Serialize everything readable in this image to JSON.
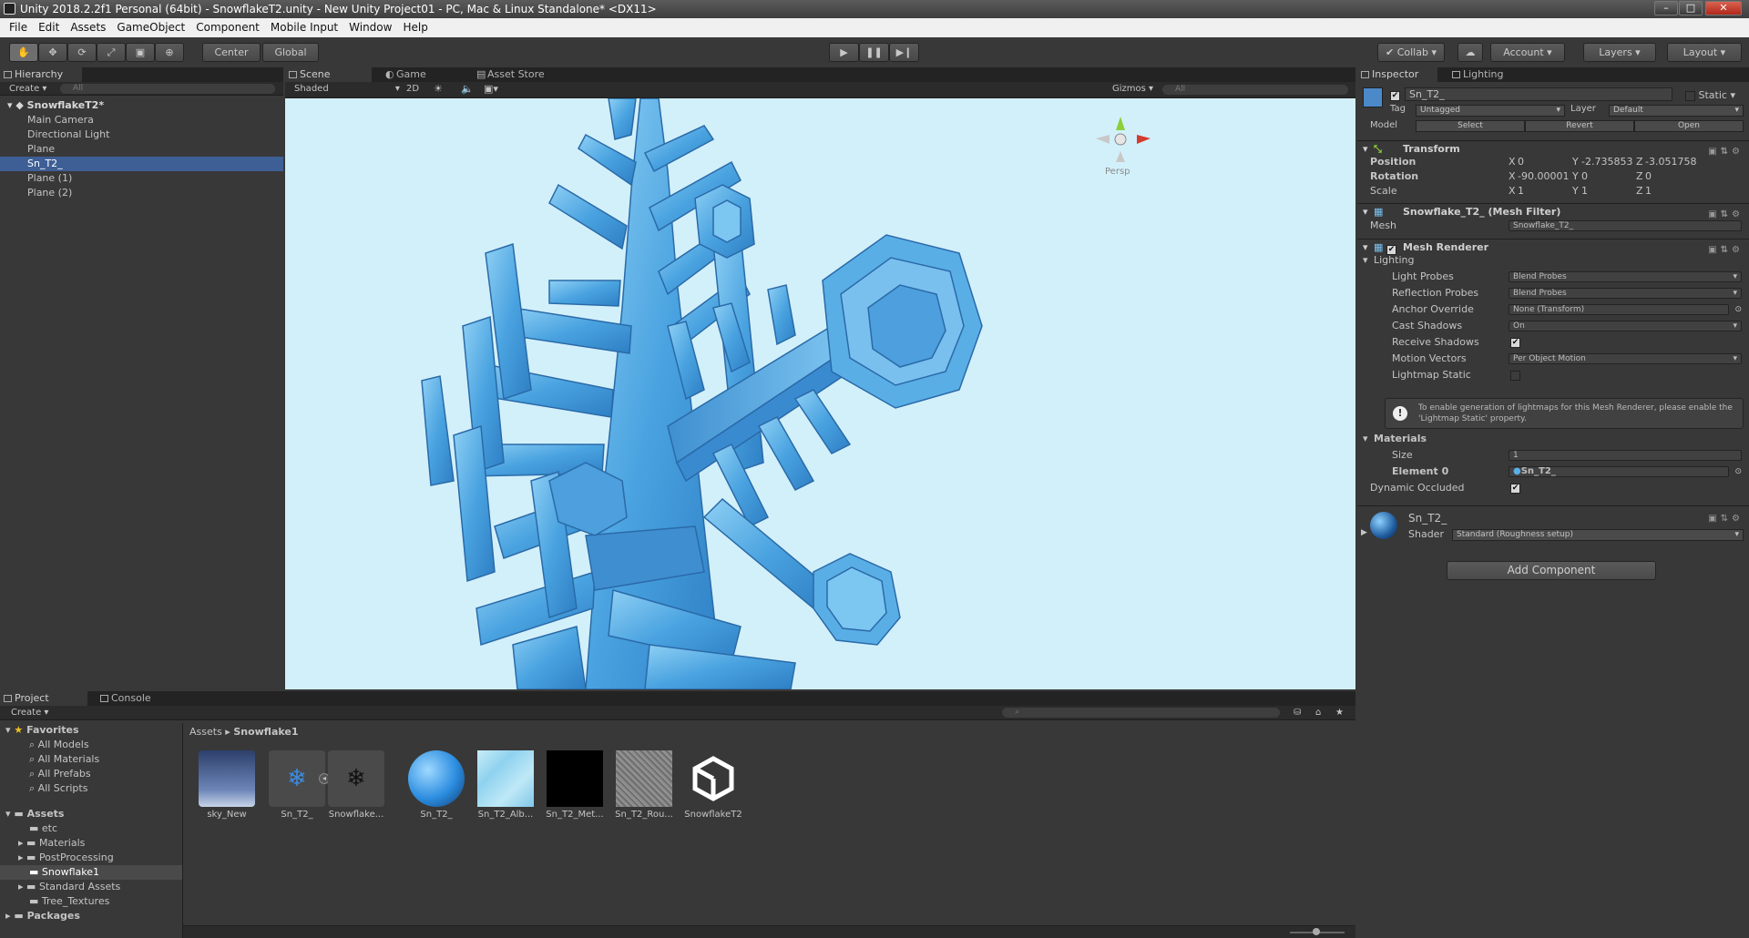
{
  "window": {
    "title": "Unity 2018.2.2f1 Personal (64bit) - SnowflakeT2.unity - New Unity Project01 - PC, Mac & Linux Standalone* <DX11>",
    "minimize": "–",
    "maximize": "□",
    "close": "✕"
  },
  "menu": [
    "File",
    "Edit",
    "Assets",
    "GameObject",
    "Component",
    "Mobile Input",
    "Window",
    "Help"
  ],
  "toolbar": {
    "pivot": "Center",
    "space": "Global",
    "collab": "Collab",
    "account": "Account",
    "layers": "Layers",
    "layout": "Layout"
  },
  "hierarchy": {
    "tab": "Hierarchy",
    "create": "Create",
    "search_placeholder": "All",
    "scene": "SnowflakeT2*",
    "items": [
      "Main Camera",
      "Directional Light",
      "Plane",
      "Sn_T2_",
      "Plane (1)",
      "Plane (2)"
    ]
  },
  "scene_view": {
    "tabs": [
      "Scene",
      "Game",
      "Asset Store"
    ],
    "shading": "Shaded",
    "mode_2d": "2D",
    "gizmos": "Gizmos",
    "search_placeholder": "All",
    "persp": "Persp"
  },
  "inspector": {
    "tabs": [
      "Inspector",
      "Lighting"
    ],
    "object_name": "Sn_T2_",
    "static": "Static",
    "tag_label": "Tag",
    "tag": "Untagged",
    "layer_label": "Layer",
    "layer": "Default",
    "model_label": "Model",
    "model_buttons": [
      "Select",
      "Revert",
      "Open"
    ],
    "transform": {
      "title": "Transform",
      "position_label": "Position",
      "position": {
        "x": "0",
        "y": "-2.735853",
        "z": "-3.051758"
      },
      "rotation_label": "Rotation",
      "rotation": {
        "x": "-90.00001",
        "y": "0",
        "z": "0"
      },
      "scale_label": "Scale",
      "scale": {
        "x": "1",
        "y": "1",
        "z": "1"
      }
    },
    "mesh_filter": {
      "title": "Snowflake_T2_ (Mesh Filter)",
      "mesh_label": "Mesh",
      "mesh": "Snowflake_T2_"
    },
    "mesh_renderer": {
      "title": "Mesh Renderer",
      "lighting": "Lighting",
      "light_probes_label": "Light Probes",
      "light_probes": "Blend Probes",
      "reflection_probes_label": "Reflection Probes",
      "reflection_probes": "Blend Probes",
      "anchor_override_label": "Anchor Override",
      "anchor_override": "None (Transform)",
      "cast_shadows_label": "Cast Shadows",
      "cast_shadows": "On",
      "receive_shadows_label": "Receive Shadows",
      "motion_vectors_label": "Motion Vectors",
      "motion_vectors": "Per Object Motion",
      "lightmap_static_label": "Lightmap Static",
      "info": "To enable generation of lightmaps for this Mesh Renderer, please enable the 'Lightmap Static' property.",
      "materials": "Materials",
      "size_label": "Size",
      "size": "1",
      "element0_label": "Element 0",
      "element0": "Sn_T2_",
      "dynamic_occluded_label": "Dynamic Occluded"
    },
    "material": {
      "name": "Sn_T2_",
      "shader_label": "Shader",
      "shader": "Standard (Roughness setup)"
    },
    "add_component": "Add Component"
  },
  "project": {
    "tabs": [
      "Project",
      "Console"
    ],
    "create": "Create",
    "favorites": "Favorites",
    "favorite_items": [
      "All Models",
      "All Materials",
      "All Prefabs",
      "All Scripts"
    ],
    "assets": "Assets",
    "asset_folders": [
      "etc",
      "Materials",
      "PostProcessing",
      "Snowflake1",
      "Standard Assets",
      "Tree_Textures"
    ],
    "packages": "Packages",
    "breadcrumb": {
      "root": "Assets",
      "current": "Snowflake1"
    },
    "files": [
      "sky_New",
      "Sn_T2_",
      "Snowflake...",
      "Sn_T2_",
      "Sn_T2_Alb...",
      "Sn_T2_Met...",
      "Sn_T2_Rou...",
      "SnowflakeT2"
    ]
  },
  "colors": {
    "selection": "#3e5f96",
    "scene_bg": "#d2f0fa",
    "ice": "#5aaee6"
  }
}
